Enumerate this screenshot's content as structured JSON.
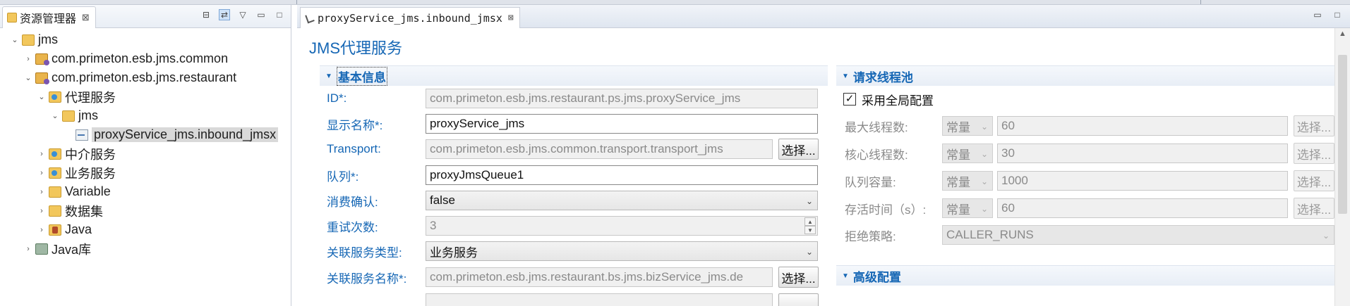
{
  "explorer": {
    "tab_title": "资源管理器",
    "tab_close": "⊠",
    "tree": [
      {
        "label": "jms",
        "icon": "project-folder-icon",
        "twisty": "⌄"
      },
      {
        "label": "com.primeton.esb.jms.common",
        "icon": "package-icon",
        "twisty": "›"
      },
      {
        "label": "com.primeton.esb.jms.restaurant",
        "icon": "package-icon",
        "twisty": "⌄"
      },
      {
        "label": "代理服务",
        "icon": "service-folder-icon",
        "twisty": "⌄"
      },
      {
        "label": "jms",
        "icon": "folder-icon",
        "twisty": "⌄"
      },
      {
        "label": "proxyService_jms.inbound_jmsx",
        "icon": "jmsx-file-icon",
        "twisty": ""
      },
      {
        "label": "中介服务",
        "icon": "service-folder-icon",
        "twisty": "›"
      },
      {
        "label": "业务服务",
        "icon": "service-folder-icon",
        "twisty": "›"
      },
      {
        "label": "Variable",
        "icon": "folder-icon",
        "twisty": "›"
      },
      {
        "label": "数据集",
        "icon": "folder-icon",
        "twisty": "›"
      },
      {
        "label": "Java",
        "icon": "java-folder-icon",
        "twisty": "›"
      },
      {
        "label": "Java库",
        "icon": "library-icon",
        "twisty": "›"
      }
    ]
  },
  "editor": {
    "tab_title": "proxyService_jms.inbound_jmsx",
    "tab_close": "⊠",
    "page_title": "JMS代理服务",
    "basic": {
      "title": "基本信息",
      "fields": [
        {
          "label": "ID*:",
          "value": "com.primeton.esb.jms.restaurant.ps.jms.proxyService_jms"
        },
        {
          "label": "显示名称*:",
          "value": "proxyService_jms"
        },
        {
          "label": "Transport:",
          "value": "com.primeton.esb.jms.common.transport.transport_jms",
          "button": "选择..."
        },
        {
          "label": "队列*:",
          "value": "proxyJmsQueue1"
        },
        {
          "label": "消费确认:",
          "value": "false"
        },
        {
          "label": "重试次数:",
          "value": "3"
        },
        {
          "label": "关联服务类型:",
          "value": "业务服务"
        },
        {
          "label": "关联服务名称*:",
          "value": "com.primeton.esb.jms.restaurant.bs.jms.bizService_jms.de",
          "button": "选择..."
        }
      ]
    },
    "pool": {
      "title": "请求线程池",
      "use_global_label": "采用全局配置",
      "use_global_checked": true,
      "rows": [
        {
          "label": "最大线程数:",
          "mode": "常量",
          "value": "60",
          "button": "选择..."
        },
        {
          "label": "核心线程数:",
          "mode": "常量",
          "value": "30",
          "button": "选择..."
        },
        {
          "label": "队列容量:",
          "mode": "常量",
          "value": "1000",
          "button": "选择..."
        },
        {
          "label": "存活时间（s）:",
          "mode": "常量",
          "value": "60",
          "button": "选择..."
        }
      ],
      "reject_label": "拒绝策略:",
      "reject_value": "CALLER_RUNS"
    },
    "advanced": {
      "title": "高级配置"
    }
  }
}
